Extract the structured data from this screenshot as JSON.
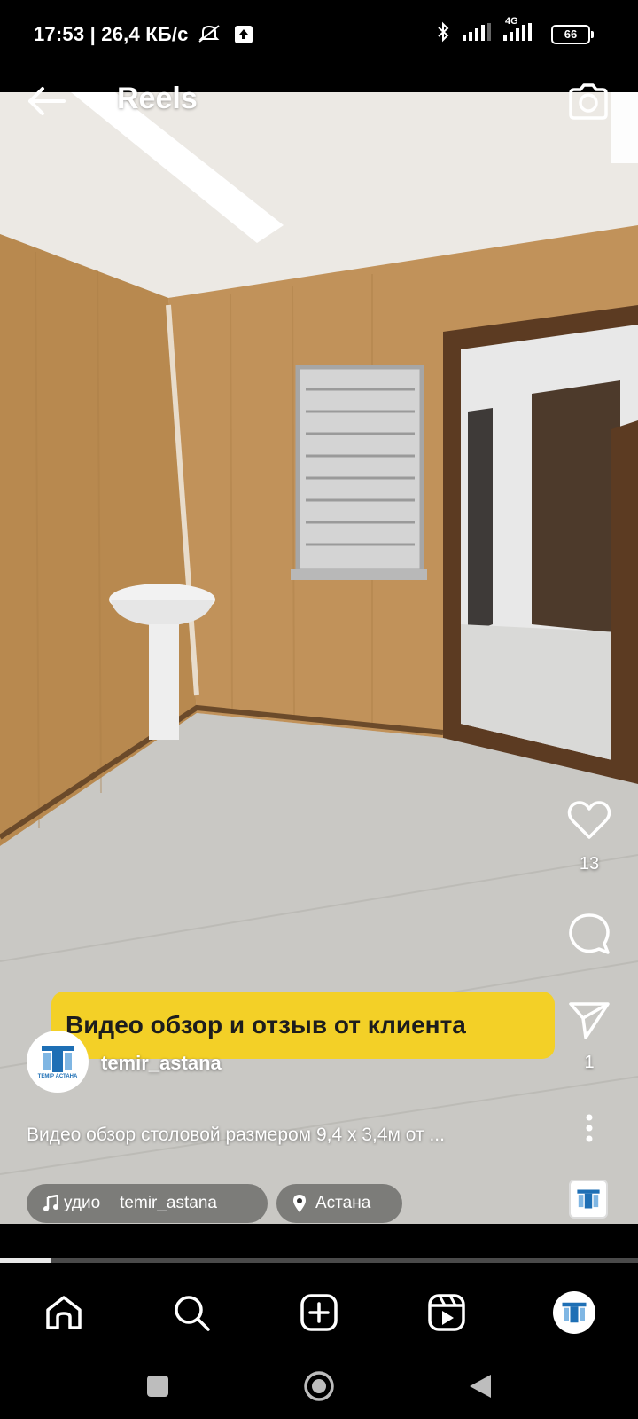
{
  "status_bar": {
    "time": "17:53",
    "network_speed": "| 26,4 КБ/с",
    "network_type": "4G",
    "battery": "66"
  },
  "header": {
    "title": "Reels",
    "back_icon": "arrow-left-icon",
    "camera_icon": "camera-icon"
  },
  "video": {
    "banner_text": "Видео обзор и отзыв от клиента",
    "progress": 0.08
  },
  "actions": {
    "like_count": "13",
    "share_count": "1"
  },
  "author": {
    "username": "temir_astana",
    "avatar_text": "ТЕМІР АСТАНА"
  },
  "caption": "Видео обзор столовой размером 9,4 х 3,4м от ...",
  "chips": {
    "audio_label": "удио",
    "audio_author": "temir_astana",
    "location": "Астана"
  },
  "bottom_nav": [
    "home-icon",
    "search-icon",
    "create-icon",
    "reels-icon",
    "profile-avatar"
  ],
  "colors": {
    "banner": "#f3d027",
    "background": "#000000"
  }
}
